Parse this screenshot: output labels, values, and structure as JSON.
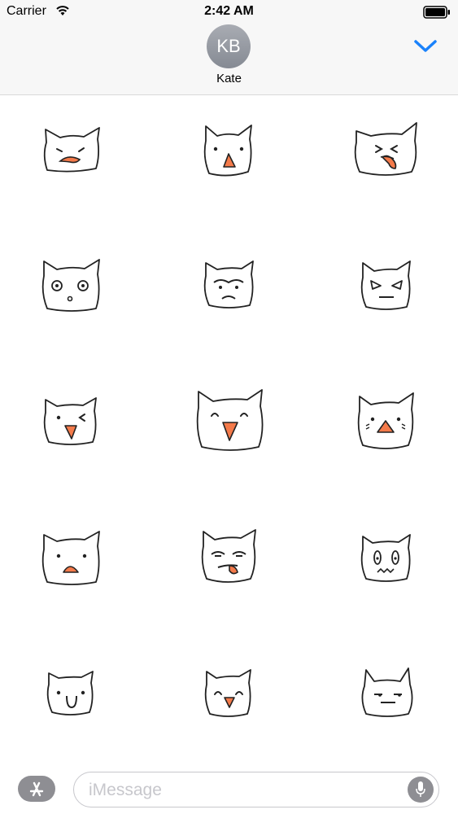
{
  "status_bar": {
    "carrier": "Carrier",
    "time": "2:42 AM"
  },
  "header": {
    "avatar_initials": "KB",
    "contact_name": "Kate"
  },
  "stickers": [
    {
      "expression": "angry-growl"
    },
    {
      "expression": "surprised-beak"
    },
    {
      "expression": "tongue-out-squint"
    },
    {
      "expression": "wide-eyed-shocked"
    },
    {
      "expression": "frowning-unibrow"
    },
    {
      "expression": "angry-glare"
    },
    {
      "expression": "winking"
    },
    {
      "expression": "happy-smiling-beak"
    },
    {
      "expression": "surprised-blush"
    },
    {
      "expression": "small-beak-open"
    },
    {
      "expression": "bored-tongue"
    },
    {
      "expression": "nervous-squiggle"
    },
    {
      "expression": "simple-smile"
    },
    {
      "expression": "happy-smile-beak"
    },
    {
      "expression": "unimpressed-flat"
    }
  ],
  "input_bar": {
    "placeholder": "iMessage"
  },
  "colors": {
    "accent": "#1a82fb",
    "beak": "#f47a4a",
    "gray_button": "#8e8e93"
  }
}
